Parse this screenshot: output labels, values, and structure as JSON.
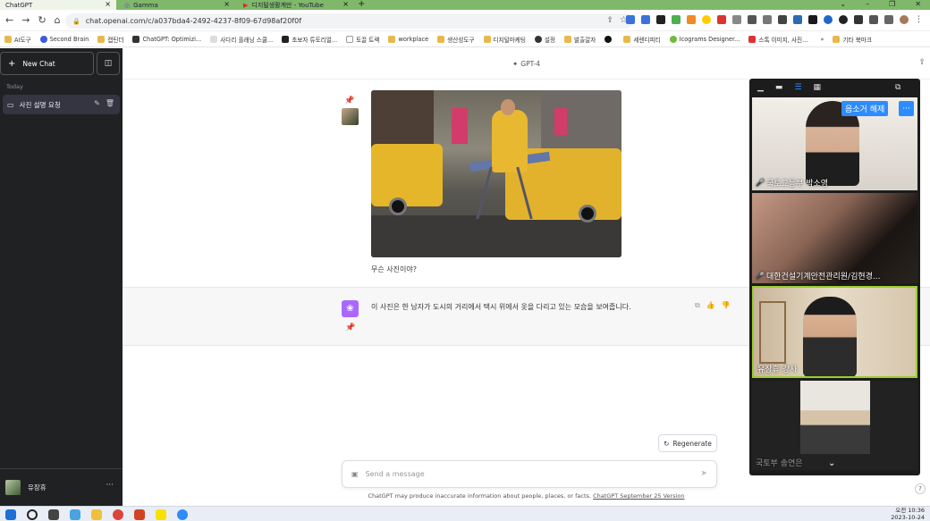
{
  "browser": {
    "tabs": [
      {
        "title": "ChatGPT"
      },
      {
        "title": "Gamma"
      },
      {
        "title": "디지털생활계만 - YouTube"
      }
    ],
    "new_tab": "+",
    "url": "chat.openai.com/c/a037bda4-2492-4237-8f09-67d98af20f0f",
    "bookmarks": [
      "AI도구",
      "Second Brain",
      "캡틴더",
      "ChatGPT: Optimizi...",
      "사다리 플래닝 스쿨...",
      "초보자 튜토리얼...",
      "토끌 트랙",
      "workplace",
      "생산성도구",
      "디지털마케팅",
      "설정",
      "발출갈자",
      "",
      "세렌디피티",
      "Icograms Designer...",
      "스톡 이미지, 사진...",
      "기타 북마크"
    ],
    "bookmarks_more": "»"
  },
  "sidebar": {
    "new_chat": "New Chat",
    "section_today": "Today",
    "chat_title": "사진 설명 요청",
    "user_name": "유장휴",
    "user_menu": "···"
  },
  "main": {
    "model": "GPT-4",
    "user_question": "무슨 사진이야?",
    "answer": "이 사진은 한 남자가 도시의 거리에서 택시 위에서 옷을 다리고 있는 모습을 보여줍니다.",
    "regenerate": "Regenerate",
    "input_placeholder": "Send a message",
    "disclaimer": "ChatGPT may produce inaccurate information about people, places, or facts.",
    "disclaimer_link": "ChatGPT September 25 Version",
    "help": "?"
  },
  "zoom": {
    "unmute_label": "음소거 해제",
    "more": "···",
    "participants": [
      {
        "name": "국토교통부 박소영",
        "muted": true
      },
      {
        "name": "대한건설기계안전관리원/김현경...",
        "muted": true
      },
      {
        "name": "유장휴 강사",
        "muted": false
      },
      {
        "name": "국토부 송연은",
        "muted": false
      }
    ]
  },
  "taskbar": {
    "time": "오전 10:36",
    "date": "2023-10-24"
  },
  "colors": {
    "tabbar": "#7fb86a",
    "sidebar": "#202123",
    "gpt_logo": "#ab68ff",
    "zoom_blue": "#2d8cff",
    "active_speaker": "#9acd32"
  }
}
